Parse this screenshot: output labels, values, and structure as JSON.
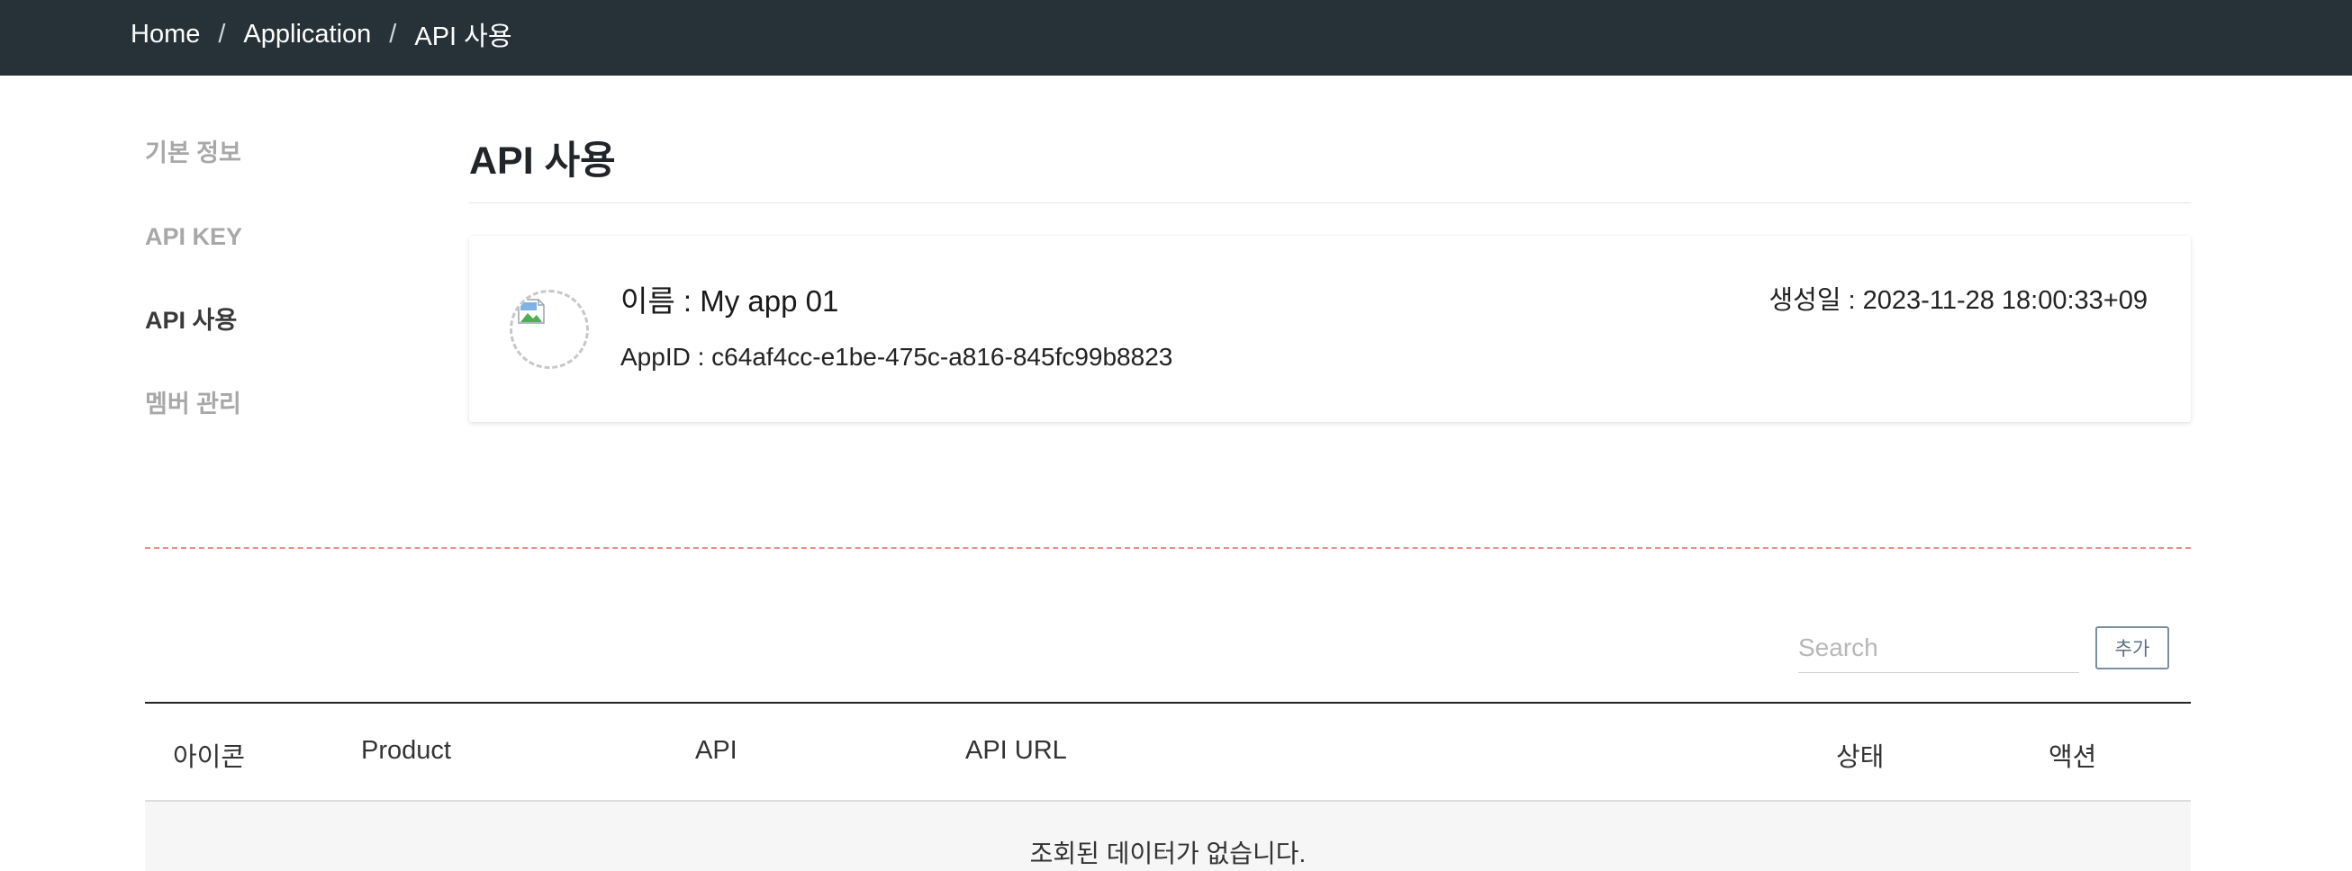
{
  "breadcrumb": {
    "items": [
      "Home",
      "Application",
      "API 사용"
    ],
    "separator": "/"
  },
  "sidebar": {
    "items": [
      {
        "label": "기본 정보",
        "active": false
      },
      {
        "label": "API KEY",
        "active": false
      },
      {
        "label": "API 사용",
        "active": true
      },
      {
        "label": "멤버 관리",
        "active": false
      }
    ]
  },
  "page": {
    "title": "API 사용"
  },
  "app_card": {
    "name_label": "이름 : ",
    "name": "My app 01",
    "app_id_label": "AppID : ",
    "app_id": "c64af4cc-e1be-475c-a816-845fc99b8823",
    "created_label": "생성일 : ",
    "created": "2023-11-28 18:00:33+09",
    "icon": "broken-image-icon"
  },
  "toolbar": {
    "search_placeholder": "Search",
    "search_value": "",
    "add_label": "추가"
  },
  "table": {
    "columns": [
      "아이콘",
      "Product",
      "API",
      "API URL",
      "상태",
      "액션"
    ],
    "empty_message": "조회된 데이터가 없습니다."
  },
  "colors": {
    "topbar": "#263238",
    "divider": "#f08a8a",
    "add_button_border": "#7b8fa3"
  }
}
